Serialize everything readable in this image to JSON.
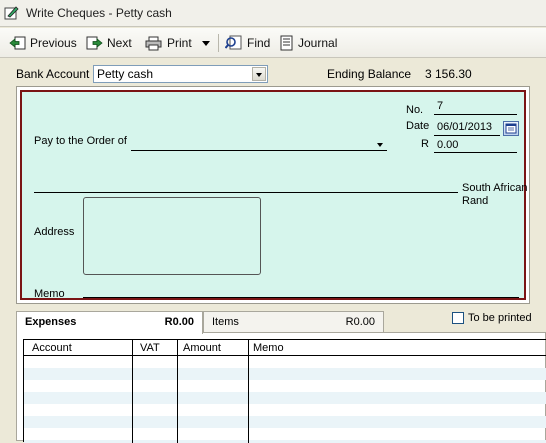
{
  "window": {
    "title": "Write Cheques - Petty cash"
  },
  "toolbar": {
    "previous": "Previous",
    "next": "Next",
    "print": "Print",
    "find": "Find",
    "journal": "Journal"
  },
  "bank": {
    "label": "Bank Account",
    "value": "Petty cash",
    "ending_label": "Ending Balance",
    "ending_value": "3 156.30"
  },
  "cheque": {
    "no_label": "No.",
    "no_value": "7",
    "date_label": "Date",
    "date_value": "06/01/2013",
    "amount_label": "R",
    "amount_value": "0.00",
    "pay_label": "Pay to the Order of",
    "pay_value": "",
    "currency": "South African Rand",
    "address_label": "Address",
    "memo_label": "Memo"
  },
  "tabs": [
    {
      "label": "Expenses",
      "amount": "R0.00"
    },
    {
      "label": "Items",
      "amount": "R0.00"
    }
  ],
  "to_be_printed": {
    "label": "To be printed",
    "checked": false
  },
  "grid": {
    "columns": [
      "Account",
      "VAT",
      "Amount",
      "Memo"
    ]
  },
  "colors": {
    "cheque_bg": "#d6f5ec",
    "cheque_border": "#7a1414",
    "window_bg": "#ece9d8"
  }
}
